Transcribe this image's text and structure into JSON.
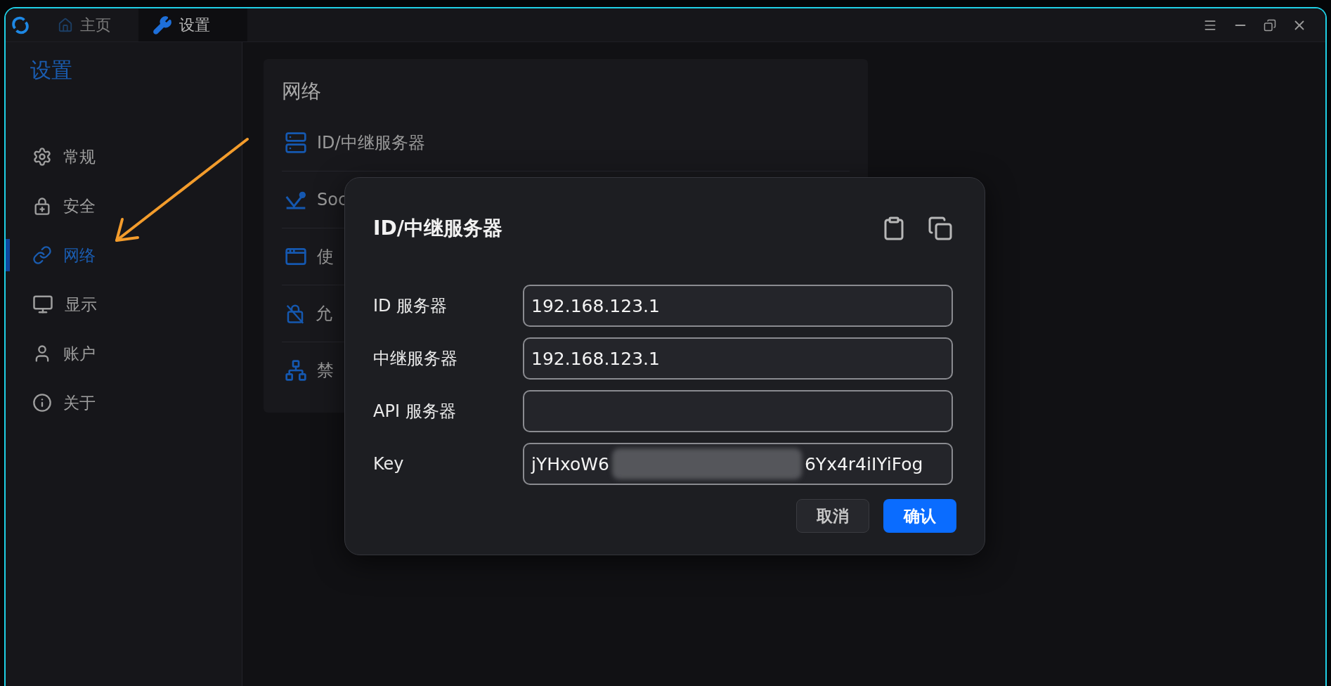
{
  "window": {
    "tabs": [
      {
        "label": "主页",
        "selected": false
      },
      {
        "label": "设置",
        "selected": true
      }
    ]
  },
  "sidebar": {
    "title": "设置",
    "items": [
      {
        "label": "常规",
        "selected": false
      },
      {
        "label": "安全",
        "selected": false
      },
      {
        "label": "网络",
        "selected": true
      },
      {
        "label": "显示",
        "selected": false
      },
      {
        "label": "账户",
        "selected": false
      },
      {
        "label": "关于",
        "selected": false
      }
    ]
  },
  "panel": {
    "title": "网络",
    "items": [
      {
        "label": "ID/中继服务器"
      },
      {
        "label": "Soc"
      },
      {
        "label": "使"
      },
      {
        "label": "允"
      },
      {
        "label": "禁"
      }
    ]
  },
  "dialog": {
    "title": "ID/中继服务器",
    "fields": [
      {
        "label": "ID 服务器",
        "value": "192.168.123.1"
      },
      {
        "label": "中继服务器",
        "value": "192.168.123.1"
      },
      {
        "label": "API 服务器"
      },
      {
        "label": "Key",
        "value_start": "jYHxoW6",
        "value_end": "6Yx4r4iIYiFog",
        "redacted": true
      }
    ],
    "buttons": [
      {
        "label": "取消",
        "kind": "secondary"
      },
      {
        "label": "确认",
        "kind": "primary"
      }
    ]
  }
}
